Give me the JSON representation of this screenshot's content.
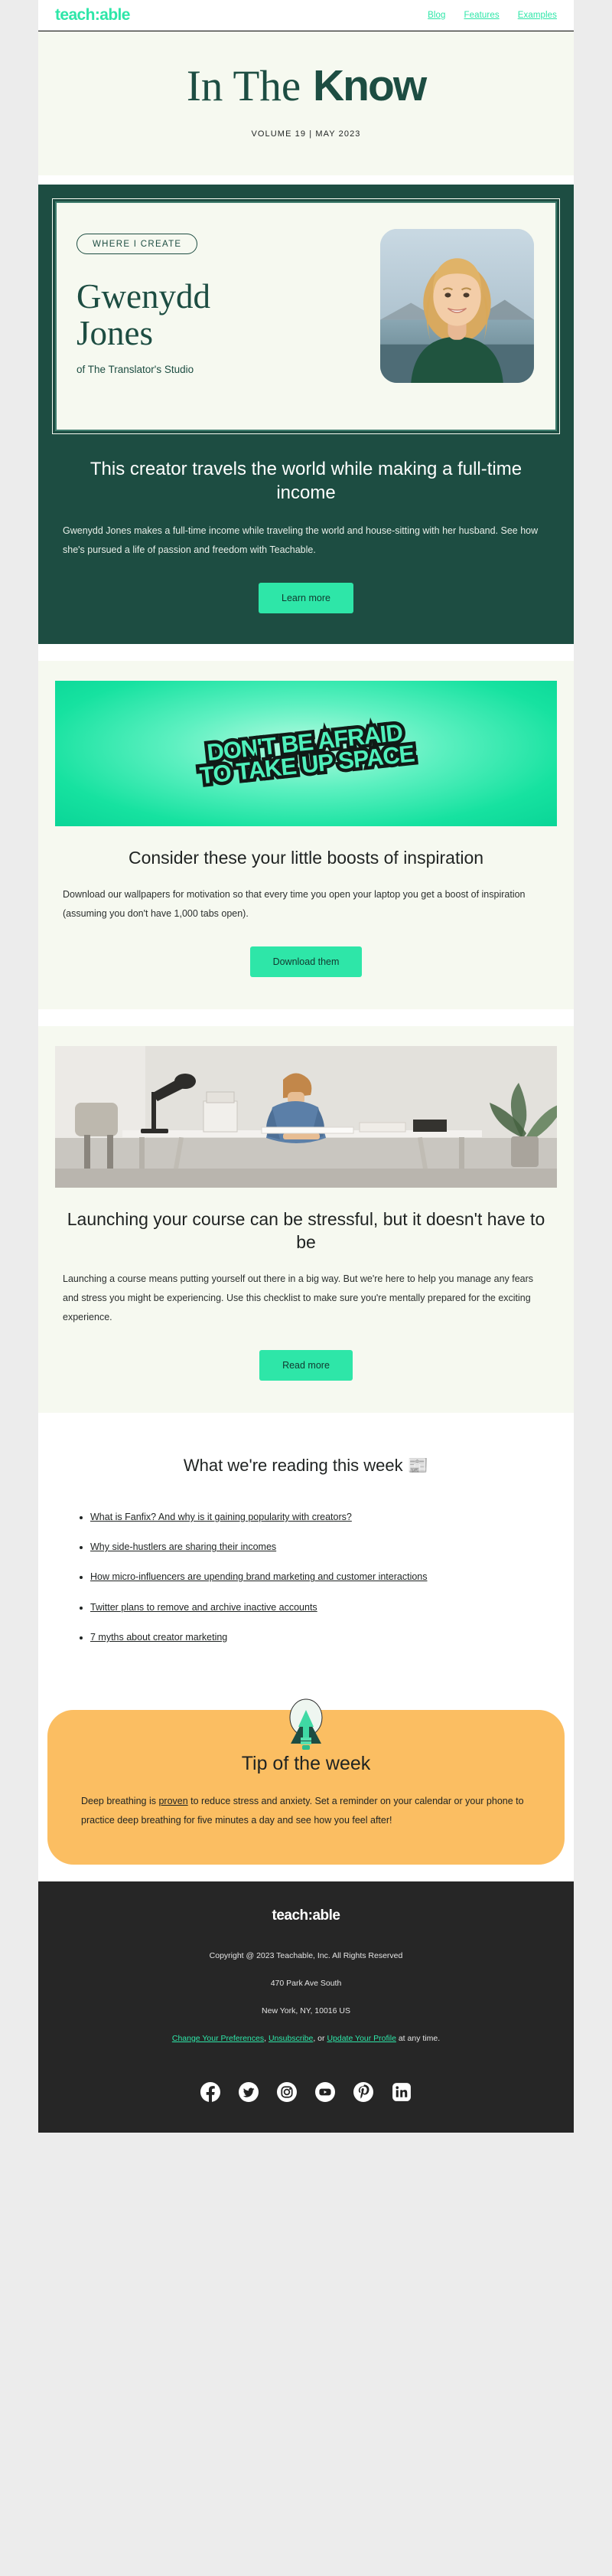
{
  "nav": {
    "logo": "teach:able",
    "links": [
      {
        "label": "Blog"
      },
      {
        "label": "Features"
      },
      {
        "label": "Examples"
      }
    ]
  },
  "masthead": {
    "title_serif": "In The",
    "title_sans": "Know",
    "subtitle": "VOLUME 19  |  MAY 2023"
  },
  "creator_block": {
    "badge": "WHERE I CREATE",
    "name_line1": "Gwenydd",
    "name_line2": "Jones",
    "role": "of The Translator's Studio",
    "heading": "This creator travels the world while making a full-time income",
    "body": "Gwenydd Jones makes a full-time income while traveling the world and house-sitting with her husband. See how she's pursued a life of passion and freedom with Teachable.",
    "button": "Learn more"
  },
  "wallpaper_block": {
    "art_line1": "DON'T BE AFRAID",
    "art_line2": "TO TAKE UP SPACE",
    "heading": "Consider these your little boosts of inspiration",
    "body": "Download our wallpapers for motivation so that every time you open your laptop you get a boost of inspiration (assuming you don't have 1,000 tabs open).",
    "button": "Download them"
  },
  "course_block": {
    "heading": "Launching your course can be stressful, but it doesn't have to be",
    "body": "Launching a course means putting yourself out there in a big way. But we're here to help you manage any fears and stress you might be experiencing. Use this checklist to make sure you're mentally prepared for the exciting experience.",
    "button": "Read more"
  },
  "reading_block": {
    "heading": "What we're reading this week 📰",
    "items": [
      {
        "label": "What is Fanfix? And why is it gaining popularity with creators?"
      },
      {
        "label": "Why side-hustlers are sharing their incomes"
      },
      {
        "label": "How micro-influencers are upending brand marketing and customer interactions"
      },
      {
        "label": "Twitter plans to remove and archive inactive accounts"
      },
      {
        "label": "7 myths about creator marketing"
      }
    ]
  },
  "tip_block": {
    "title": "Tip of the week",
    "body_before": "Deep breathing is ",
    "body_link": "proven",
    "body_after": " to reduce stress and anxiety. Set a reminder on your calendar or your phone to practice deep breathing for five minutes a day and see how you feel after!"
  },
  "footer": {
    "logo": "teach:able",
    "copyright": "Copyright @ 2023 Teachable, Inc. All Rights Reserved",
    "address1": "470 Park Ave South",
    "address2": "New York, NY, 10016 US",
    "pref_link": "Change Your Preferences",
    "unsub_link": "Unsubscribe",
    "or_text": ", or ",
    "profile_link": "Update Your Profile",
    "tail_text": " at any time.",
    "comma_text": ", ",
    "socials": [
      {
        "name": "facebook-icon"
      },
      {
        "name": "twitter-icon"
      },
      {
        "name": "instagram-icon"
      },
      {
        "name": "youtube-icon"
      },
      {
        "name": "pinterest-icon"
      },
      {
        "name": "linkedin-icon"
      }
    ]
  },
  "colors": {
    "brand_green": "#2EE6A8",
    "dark_green": "#1D4D42",
    "cream": "#F6F9F0",
    "tip_orange": "#FBBE62",
    "footer_dark": "#262626"
  }
}
